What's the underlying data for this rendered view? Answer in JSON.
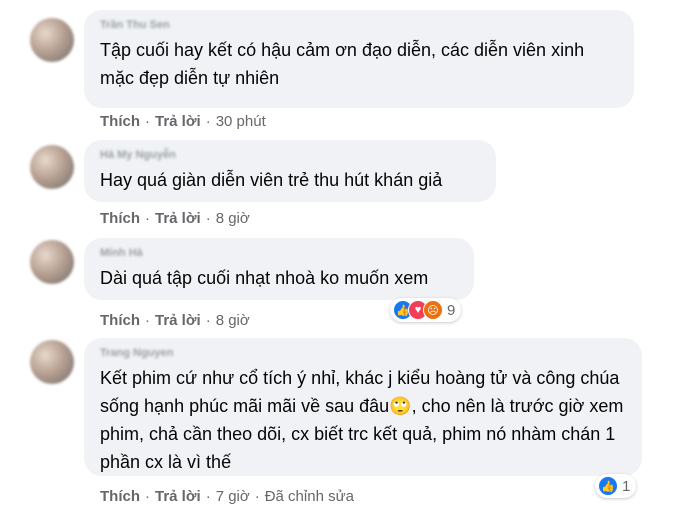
{
  "actions_labels": {
    "like": "Thích",
    "reply": "Trả lời",
    "separator": "·"
  },
  "comments": [
    {
      "author": "Trần Thu Sen",
      "text": "Tập cuối hay kết có hậu cảm ơn đạo diễn, các diễn viên xinh mặc đẹp diễn tự nhiên",
      "time": "30 phút"
    },
    {
      "author": "Hà My Nguyễn",
      "text": "Hay quá giàn diễn viên trẻ thu hút khán giả",
      "time": "8 giờ"
    },
    {
      "author": "Minh Hà",
      "text": "Dài quá tập cuối nhạt nhoà ko muốn xem",
      "time": "8 giờ",
      "reactions": {
        "types": [
          "like-icon",
          "love-icon",
          "angry-icon"
        ],
        "count": "9"
      }
    },
    {
      "author": "Trang Nguyen",
      "text": "Kết phim cứ như cổ tích ý nhỉ, khác j kiểu hoàng tử và công chúa sống hạnh phúc mãi mãi về sau đâu🙄, cho nên là trước giờ xem phim, chả cần theo dõi, cx biết trc kết quả, phim nó nhàm chán 1 phần cx là vì thế",
      "time": "7 giờ",
      "edited": "Đã chỉnh sửa",
      "reactions": {
        "types": [
          "like-icon"
        ],
        "count": "1"
      }
    }
  ]
}
